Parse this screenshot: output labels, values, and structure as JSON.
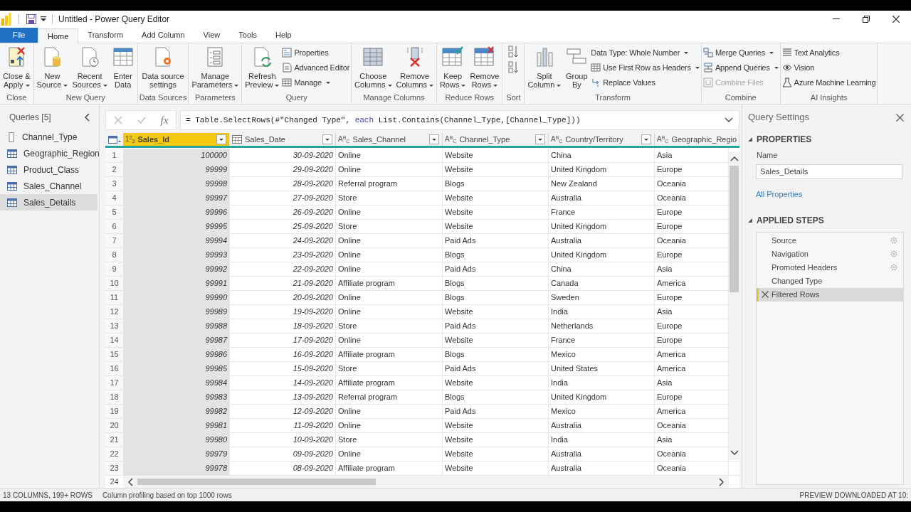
{
  "window": {
    "title": "Untitled - Power Query Editor"
  },
  "tabs": [
    {
      "label": "File",
      "kind": "file",
      "selected": false
    },
    {
      "label": "Home",
      "kind": "tab",
      "selected": true
    },
    {
      "label": "Transform",
      "kind": "tab",
      "selected": false
    },
    {
      "label": "Add Column",
      "kind": "tab",
      "selected": false
    },
    {
      "label": "View",
      "kind": "tab",
      "selected": false
    },
    {
      "label": "Tools",
      "kind": "tab",
      "selected": false
    },
    {
      "label": "Help",
      "kind": "tab",
      "selected": false
    }
  ],
  "ribbon": {
    "groups": [
      {
        "label": "Close",
        "items": [
          {
            "kind": "large",
            "label": "Close &\nApply",
            "dropdown": true
          }
        ]
      },
      {
        "label": "New Query",
        "items": [
          {
            "kind": "large",
            "label": "New\nSource",
            "dropdown": true
          },
          {
            "kind": "large",
            "label": "Recent\nSources",
            "dropdown": true
          },
          {
            "kind": "large",
            "label": "Enter\nData",
            "dropdown": false
          }
        ]
      },
      {
        "label": "Data Sources",
        "items": [
          {
            "kind": "large",
            "label": "Data source\nsettings",
            "dropdown": false
          }
        ]
      },
      {
        "label": "Parameters",
        "items": [
          {
            "kind": "large",
            "label": "Manage\nParameters",
            "dropdown": true
          }
        ]
      },
      {
        "label": "Query",
        "items": [
          {
            "kind": "large",
            "label": "Refresh\nPreview",
            "dropdown": true
          },
          {
            "kind": "stack",
            "items": [
              {
                "label": "Properties",
                "dropdown": false,
                "disabled": false
              },
              {
                "label": "Advanced Editor",
                "dropdown": false,
                "disabled": false
              },
              {
                "label": "Manage",
                "dropdown": true,
                "disabled": false
              }
            ]
          }
        ]
      },
      {
        "label": "Manage Columns",
        "items": [
          {
            "kind": "large",
            "label": "Choose\nColumns",
            "dropdown": true
          },
          {
            "kind": "large",
            "label": "Remove\nColumns",
            "dropdown": true
          }
        ]
      },
      {
        "label": "Reduce Rows",
        "items": [
          {
            "kind": "large",
            "label": "Keep\nRows",
            "dropdown": true
          },
          {
            "kind": "large",
            "label": "Remove\nRows",
            "dropdown": true
          }
        ]
      },
      {
        "label": "Sort",
        "items": [
          {
            "kind": "sort"
          }
        ]
      },
      {
        "label": "Transform",
        "items": [
          {
            "kind": "large",
            "label": "Split\nColumn",
            "dropdown": true
          },
          {
            "kind": "large",
            "label": "Group\nBy",
            "dropdown": false
          },
          {
            "kind": "stack",
            "items": [
              {
                "label": "Data Type: Whole Number",
                "dropdown": true,
                "disabled": false
              },
              {
                "label": "Use First Row as Headers",
                "dropdown": true,
                "disabled": false
              },
              {
                "label": "Replace Values",
                "dropdown": false,
                "disabled": false
              }
            ]
          }
        ]
      },
      {
        "label": "Combine",
        "items": [
          {
            "kind": "stack",
            "items": [
              {
                "label": "Merge Queries",
                "dropdown": true,
                "disabled": false
              },
              {
                "label": "Append Queries",
                "dropdown": true,
                "disabled": false
              },
              {
                "label": "Combine Files",
                "dropdown": false,
                "disabled": true
              }
            ]
          }
        ]
      },
      {
        "label": "AI Insights",
        "items": [
          {
            "kind": "stack",
            "items": [
              {
                "label": "Text Analytics",
                "dropdown": false,
                "disabled": false
              },
              {
                "label": "Vision",
                "dropdown": false,
                "disabled": false
              },
              {
                "label": "Azure Machine Learning",
                "dropdown": false,
                "disabled": false
              }
            ]
          }
        ]
      }
    ]
  },
  "queries": {
    "title": "Queries [5]",
    "items": [
      {
        "label": "Channel_Type",
        "kind": "list",
        "selected": false
      },
      {
        "label": "Geographic_Region",
        "kind": "table",
        "selected": false
      },
      {
        "label": "Product_Class",
        "kind": "table",
        "selected": false
      },
      {
        "label": "Sales_Channel",
        "kind": "table",
        "selected": false
      },
      {
        "label": "Sales_Details",
        "kind": "table",
        "selected": true
      }
    ]
  },
  "formula_bar": {
    "fx": "fx",
    "parts": [
      {
        "text": "= Table.SelectRows(#\"Changed Type\", ",
        "kind": "plain"
      },
      {
        "text": "each",
        "kind": "keyword"
      },
      {
        "text": " List.Contains(Channel_Type,[Channel_Type]))",
        "kind": "plain"
      }
    ]
  },
  "table": {
    "columns": [
      {
        "name": "Sales_Id",
        "kind": "number",
        "type_label": "1$^{2}$$_{3}$",
        "selected": true
      },
      {
        "name": "Sales_Date",
        "kind": "date",
        "selected": false
      },
      {
        "name": "Sales_Channel",
        "kind": "text",
        "type_label": "A$^{B}$$_{C}$",
        "selected": false
      },
      {
        "name": "Channel_Type",
        "kind": "text",
        "type_label": "A$^{B}$$_{C}$",
        "selected": false
      },
      {
        "name": "Country/Territory",
        "kind": "text",
        "type_label": "A$^{B}$$_{C}$",
        "selected": false
      },
      {
        "name": "Geographic_Regio",
        "kind": "text",
        "type_label": "A$^{B}$$_{C}$",
        "selected": false
      }
    ],
    "rows": [
      {
        "number": "1",
        "cells": [
          "100000",
          "30-09-2020",
          "Online",
          "Website",
          "China",
          "Asia"
        ]
      },
      {
        "number": "2",
        "cells": [
          "99999",
          "29-09-2020",
          "Online",
          "Website",
          "United Kingdom",
          "Europe"
        ]
      },
      {
        "number": "3",
        "cells": [
          "99998",
          "28-09-2020",
          "Referral program",
          "Blogs",
          "New Zealand",
          "Oceania"
        ]
      },
      {
        "number": "4",
        "cells": [
          "99997",
          "27-09-2020",
          "Store",
          "Website",
          "Australia",
          "Oceania"
        ]
      },
      {
        "number": "5",
        "cells": [
          "99996",
          "26-09-2020",
          "Online",
          "Website",
          "France",
          "Europe"
        ]
      },
      {
        "number": "6",
        "cells": [
          "99995",
          "25-09-2020",
          "Store",
          "Website",
          "United Kingdom",
          "Europe"
        ]
      },
      {
        "number": "7",
        "cells": [
          "99994",
          "24-09-2020",
          "Online",
          "Paid Ads",
          "Australia",
          "Oceania"
        ]
      },
      {
        "number": "8",
        "cells": [
          "99993",
          "23-09-2020",
          "Online",
          "Blogs",
          "United Kingdom",
          "Europe"
        ]
      },
      {
        "number": "9",
        "cells": [
          "99992",
          "22-09-2020",
          "Online",
          "Paid Ads",
          "China",
          "Asia"
        ]
      },
      {
        "number": "10",
        "cells": [
          "99991",
          "21-09-2020",
          "Affiliate program",
          "Blogs",
          "Canada",
          "America"
        ]
      },
      {
        "number": "11",
        "cells": [
          "99990",
          "20-09-2020",
          "Online",
          "Blogs",
          "Sweden",
          "Europe"
        ]
      },
      {
        "number": "12",
        "cells": [
          "99989",
          "19-09-2020",
          "Online",
          "Website",
          "India",
          "Asia"
        ]
      },
      {
        "number": "13",
        "cells": [
          "99988",
          "18-09-2020",
          "Store",
          "Paid Ads",
          "Netherlands",
          "Europe"
        ]
      },
      {
        "number": "14",
        "cells": [
          "99987",
          "17-09-2020",
          "Online",
          "Website",
          "France",
          "Europe"
        ]
      },
      {
        "number": "15",
        "cells": [
          "99986",
          "16-09-2020",
          "Affiliate program",
          "Blogs",
          "Mexico",
          "America"
        ]
      },
      {
        "number": "16",
        "cells": [
          "99985",
          "15-09-2020",
          "Store",
          "Paid Ads",
          "United States",
          "America"
        ]
      },
      {
        "number": "17",
        "cells": [
          "99984",
          "14-09-2020",
          "Affiliate program",
          "Website",
          "India",
          "Asia"
        ]
      },
      {
        "number": "18",
        "cells": [
          "99983",
          "13-09-2020",
          "Referral program",
          "Blogs",
          "United Kingdom",
          "Europe"
        ]
      },
      {
        "number": "19",
        "cells": [
          "99982",
          "12-09-2020",
          "Online",
          "Paid Ads",
          "Mexico",
          "America"
        ]
      },
      {
        "number": "20",
        "cells": [
          "99981",
          "11-09-2020",
          "Online",
          "Website",
          "Australia",
          "Oceania"
        ]
      },
      {
        "number": "21",
        "cells": [
          "99980",
          "10-09-2020",
          "Store",
          "Website",
          "India",
          "Asia"
        ]
      },
      {
        "number": "22",
        "cells": [
          "99979",
          "09-09-2020",
          "Online",
          "Website",
          "Australia",
          "Oceania"
        ]
      },
      {
        "number": "23",
        "cells": [
          "99978",
          "08-09-2020",
          "Affiliate program",
          "Website",
          "Australia",
          "Oceania"
        ]
      }
    ],
    "last_row_number": "24"
  },
  "query_settings": {
    "title": "Query Settings",
    "properties_heading": "PROPERTIES",
    "name_label": "Name",
    "name_value": "Sales_Details",
    "all_properties": "All Properties",
    "steps_heading": "APPLIED STEPS",
    "steps": [
      {
        "label": "Source",
        "has_settings": true,
        "selected": false
      },
      {
        "label": "Navigation",
        "has_settings": true,
        "selected": false
      },
      {
        "label": "Promoted Headers",
        "has_settings": true,
        "selected": false
      },
      {
        "label": "Changed Type",
        "has_settings": false,
        "selected": false
      },
      {
        "label": "Filtered Rows",
        "has_settings": false,
        "selected": true
      }
    ]
  },
  "status_bar": {
    "left": "13 COLUMNS, 199+ ROWS",
    "profiling": "Column profiling based on top 1000 rows",
    "right": "PREVIEW DOWNLOADED AT 10:"
  }
}
